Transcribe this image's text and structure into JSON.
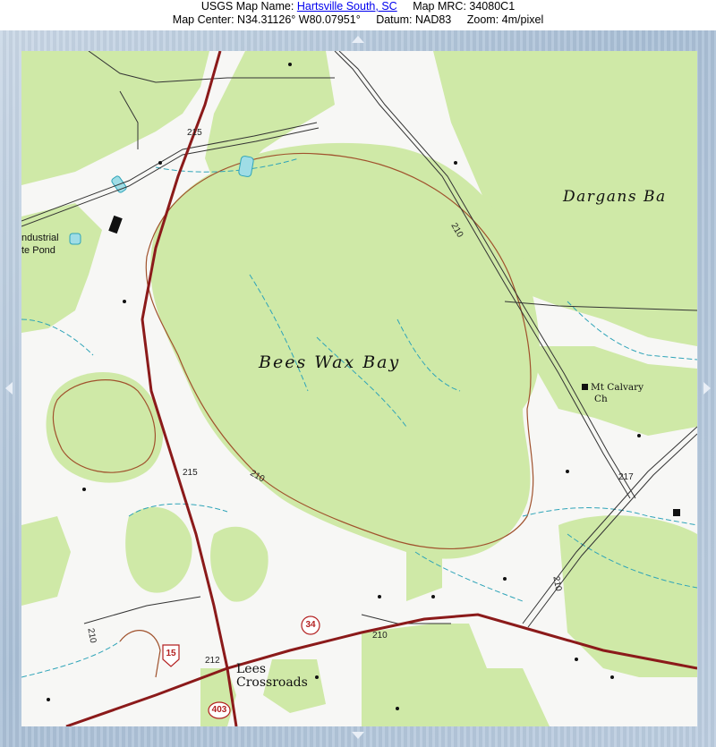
{
  "header": {
    "map_name_label": "USGS Map Name:",
    "map_name_link": "Hartsville South, SC",
    "map_mrc_label": "Map MRC:",
    "map_mrc_value": "34080C1",
    "map_center_label": "Map Center:",
    "map_center_lat": "N34.31126°",
    "map_center_lon": "W80.07951°",
    "datum_label": "Datum:",
    "datum_value": "NAD83",
    "zoom_label": "Zoom:",
    "zoom_value": "4m/pixel"
  },
  "map": {
    "place_labels": {
      "bees_wax_bay": "Bees Wax Bay",
      "dargans_bay": "Dargans Ba",
      "industrial_line1": "ndustrial",
      "industrial_line2": "te Pond",
      "mt_calvary_line1": "Mt Calvary",
      "mt_calvary_line2": "Ch",
      "lees_line1": "Lees",
      "lees_line2": "Crossroads"
    },
    "elevation_labels": {
      "e215_top": "215",
      "e210_top": "210",
      "e215_mid": "215",
      "e210_mid": "210",
      "e217": "217",
      "e210_right": "210",
      "e210_road": "210",
      "e210_left": "210",
      "e212": "212"
    },
    "route_shields": {
      "route_15": "15",
      "route_34": "34",
      "route_403": "403"
    },
    "colors": {
      "vegetation": "#cfe9a7",
      "road_red": "#8b1a1a",
      "contour": "#a0522d",
      "water": "#2fa4b8"
    }
  },
  "navigation": {
    "pan_up": "▲",
    "pan_down": "▼",
    "pan_left": "◀",
    "pan_right": "▶"
  }
}
